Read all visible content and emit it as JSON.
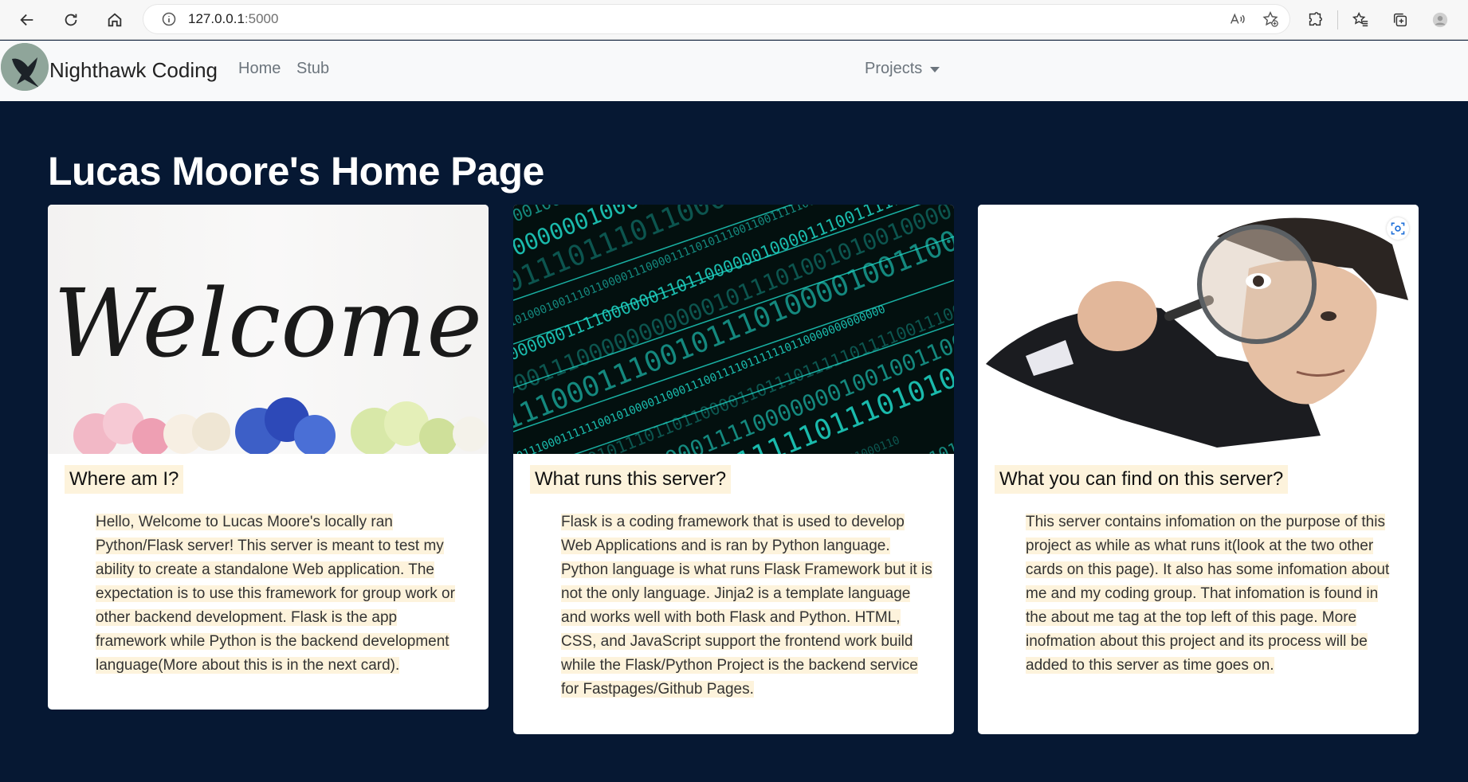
{
  "browser": {
    "url_host": "127.0.0.1",
    "url_port": ":5000"
  },
  "navbar": {
    "brand": "Nighthawk Coding",
    "links": [
      "Home",
      "Stub"
    ],
    "dropdown_label": "Projects"
  },
  "page": {
    "title": "Lucas Moore's Home Page"
  },
  "cards": [
    {
      "title": "Where am I?",
      "image_text": "Welcome",
      "text": " Hello, Welcome to Lucas Moore's locally ran Python/Flask server! This server is meant to test my ability to create a standalone Web application. The expectation is to use this framework for group work or other backend development. Flask is the app framework while Python is the backend development language(More about this is in the next card).  "
    },
    {
      "title": "What runs this server?",
      "text": " Flask is a coding framework that is used to develop Web Applications and is ran by Python language. Python language is what runs Flask Framework but it is not the only language. Jinja2 is a template language and works well with both Flask and Python. HTML, CSS, and JavaScript support the frontend work build while the Flask/Python Project is the backend service for Fastpages/Github Pages."
    },
    {
      "title": "What you can find on this server?",
      "text": " This server contains infomation on the purpose of this project as while as what runs it(look at the two other cards on this page). It also has some infomation about me and my coding group. That infomation is found in the about me tag at the top left of this page. More inofmation about this project and its process will be added to this server as time goes on.  "
    }
  ],
  "colors": {
    "background": "#061833",
    "highlight": "#fdf3dc",
    "matrix": "#1fd8c8"
  }
}
